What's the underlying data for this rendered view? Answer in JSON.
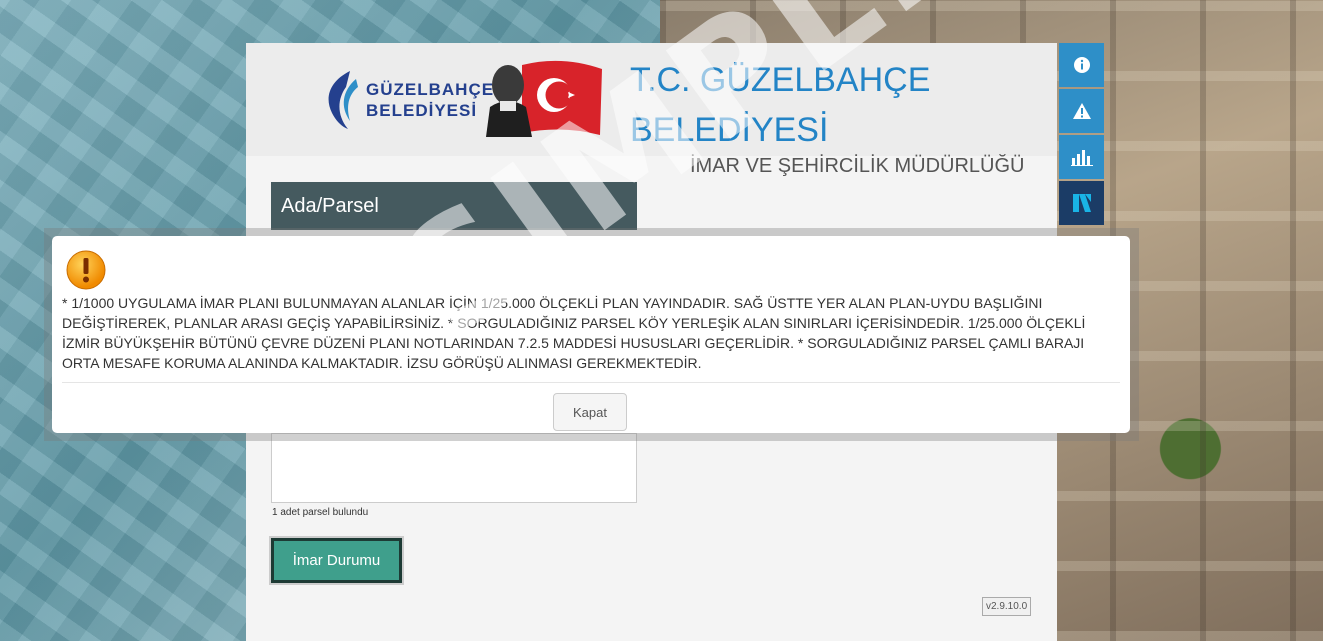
{
  "header": {
    "logo_line1": "GÜZELBAHÇE",
    "logo_line2": "BELEDİYESİ",
    "title_line1": "T.C. GÜZELBAHÇE",
    "title_line2": "BELEDİYESİ",
    "subtitle": "İMAR VE ŞEHİRCİLİK MÜDÜRLÜĞÜ"
  },
  "search": {
    "label": "Ada/Parsel"
  },
  "results": {
    "count_text": "1 adet parsel bulundu"
  },
  "actions": {
    "imar_button": "İmar Durumu"
  },
  "version": "v2.9.10.0",
  "toolbar": {
    "items": [
      "info-icon",
      "warning-icon",
      "chart-icon",
      "netcad-logo-icon"
    ]
  },
  "watermark": "SIMPLEKEY",
  "modal": {
    "message": "* 1/1000 UYGULAMA İMAR PLANI BULUNMAYAN ALANLAR İÇİN 1/25.000 ÖLÇEKLİ PLAN YAYINDADIR. SAĞ ÜSTTE YER ALAN PLAN-UYDU BAŞLIĞINI DEĞİŞTİREREK, PLANLAR ARASI GEÇİŞ YAPABİLİRSİNİZ. * SORGULADIĞINIZ PARSEL KÖY YERLEŞİK ALAN SINIRLARI İÇERİSİNDEDİR. 1/25.000 ÖLÇEKLİ İZMİR BÜYÜKŞEHİR BÜTÜNÜ ÇEVRE DÜZENİ PLANI NOTLARINDAN 7.2.5 MADDESİ HUSUSLARI GEÇERLİDİR. * SORGULADIĞINIZ PARSEL ÇAMLI BARAJI ORTA MESAFE KORUMA ALANINDA KALMAKTADIR. İZSU GÖRÜŞÜ ALINMASI GEREKMEKTEDİR.",
    "close_label": "Kapat"
  },
  "colors": {
    "title_blue": "#2384c6",
    "toolbar_blue": "#2e8fc8",
    "imar_button": "#3f9f8c",
    "search_label_bg": "#455a5f"
  }
}
